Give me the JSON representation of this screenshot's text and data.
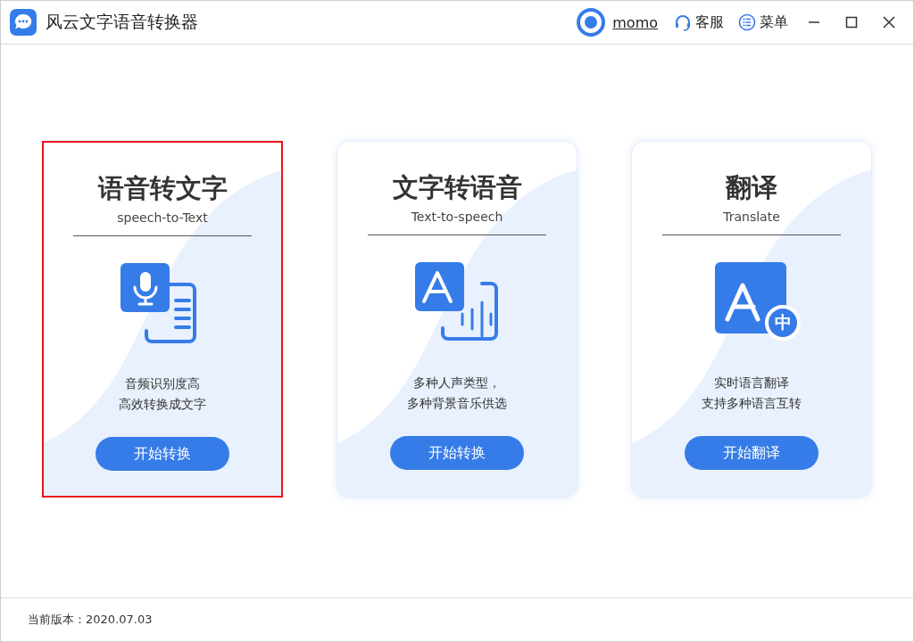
{
  "window": {
    "title": "风云文字语音转换器",
    "user": "momo",
    "actions": [
      {
        "kind": "support",
        "label": "客服"
      },
      {
        "kind": "menu",
        "label": "菜单"
      }
    ]
  },
  "cards": [
    {
      "kind": "speech",
      "title": "语音转文字",
      "subtitle": "speech-to-Text",
      "lines": [
        "音频识别度高",
        "高效转换成文字"
      ],
      "button": "开始转换",
      "selected": true
    },
    {
      "kind": "tts",
      "title": "文字转语音",
      "subtitle": "Text-to-speech",
      "lines": [
        "多种人声类型，",
        "多种背景音乐供选"
      ],
      "button": "开始转换",
      "selected": false
    },
    {
      "kind": "translate",
      "title": "翻译",
      "subtitle": "Translate",
      "badge": "中",
      "lines": [
        "实时语言翻译",
        "支持多种语言互转"
      ],
      "button": "开始翻译",
      "selected": false
    }
  ],
  "status_bar": {
    "version": "当前版本：2020.07.03"
  }
}
